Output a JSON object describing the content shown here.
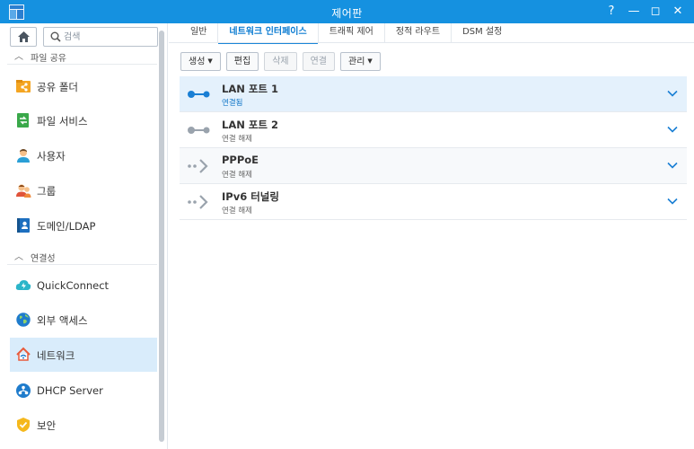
{
  "window": {
    "title": "제어판",
    "controls": [
      "?",
      "—",
      "◻",
      "✕"
    ]
  },
  "sidebar": {
    "search_placeholder": "검색",
    "sections": [
      {
        "label": "파일 공유",
        "items": [
          {
            "label": "공유 폴더",
            "icon": "shared-folder-icon",
            "color": "#f4a522"
          },
          {
            "label": "파일 서비스",
            "icon": "file-services-icon",
            "color": "#3aa84a"
          },
          {
            "label": "사용자",
            "icon": "user-icon",
            "color": "#f08a3c"
          },
          {
            "label": "그룹",
            "icon": "group-icon",
            "color": "#f08a3c"
          },
          {
            "label": "도메인/LDAP",
            "icon": "domain-ldap-icon",
            "color": "#1d6fbf"
          }
        ]
      },
      {
        "label": "연결성",
        "items": [
          {
            "label": "QuickConnect",
            "icon": "quickconnect-icon",
            "color": "#2bb5c9"
          },
          {
            "label": "외부 액세스",
            "icon": "external-access-icon",
            "color": "#1f7ccc"
          },
          {
            "label": "네트워크",
            "icon": "network-icon",
            "color": "#e85a3a",
            "active": true
          },
          {
            "label": "DHCP Server",
            "icon": "dhcp-server-icon",
            "color": "#1f7ccc"
          },
          {
            "label": "보안",
            "icon": "security-icon",
            "color": "#f5b81c"
          }
        ]
      }
    ]
  },
  "tabs": [
    {
      "label": "일반"
    },
    {
      "label": "네트워크 인터페이스",
      "active": true
    },
    {
      "label": "트래픽 제어"
    },
    {
      "label": "정적 라우트"
    },
    {
      "label": "DSM 설정"
    }
  ],
  "toolbar": {
    "create": "생성",
    "edit": "편집",
    "delete": "삭제",
    "connect": "연결",
    "manage": "관리"
  },
  "interfaces": [
    {
      "name": "LAN 포트 1",
      "status": "연결됨",
      "state": "connected"
    },
    {
      "name": "LAN 포트 2",
      "status": "연결 해제",
      "state": "disconnected"
    },
    {
      "name": "PPPoE",
      "status": "연결 해제",
      "state": "disconnected"
    },
    {
      "name": "IPv6 터널링",
      "status": "연결 해제",
      "state": "disconnected"
    }
  ],
  "colors": {
    "titlebar": "#1591e0",
    "accent": "#0a7bd1",
    "selected_row": "#e4f1fc",
    "active_nav": "#d9ecfb"
  }
}
